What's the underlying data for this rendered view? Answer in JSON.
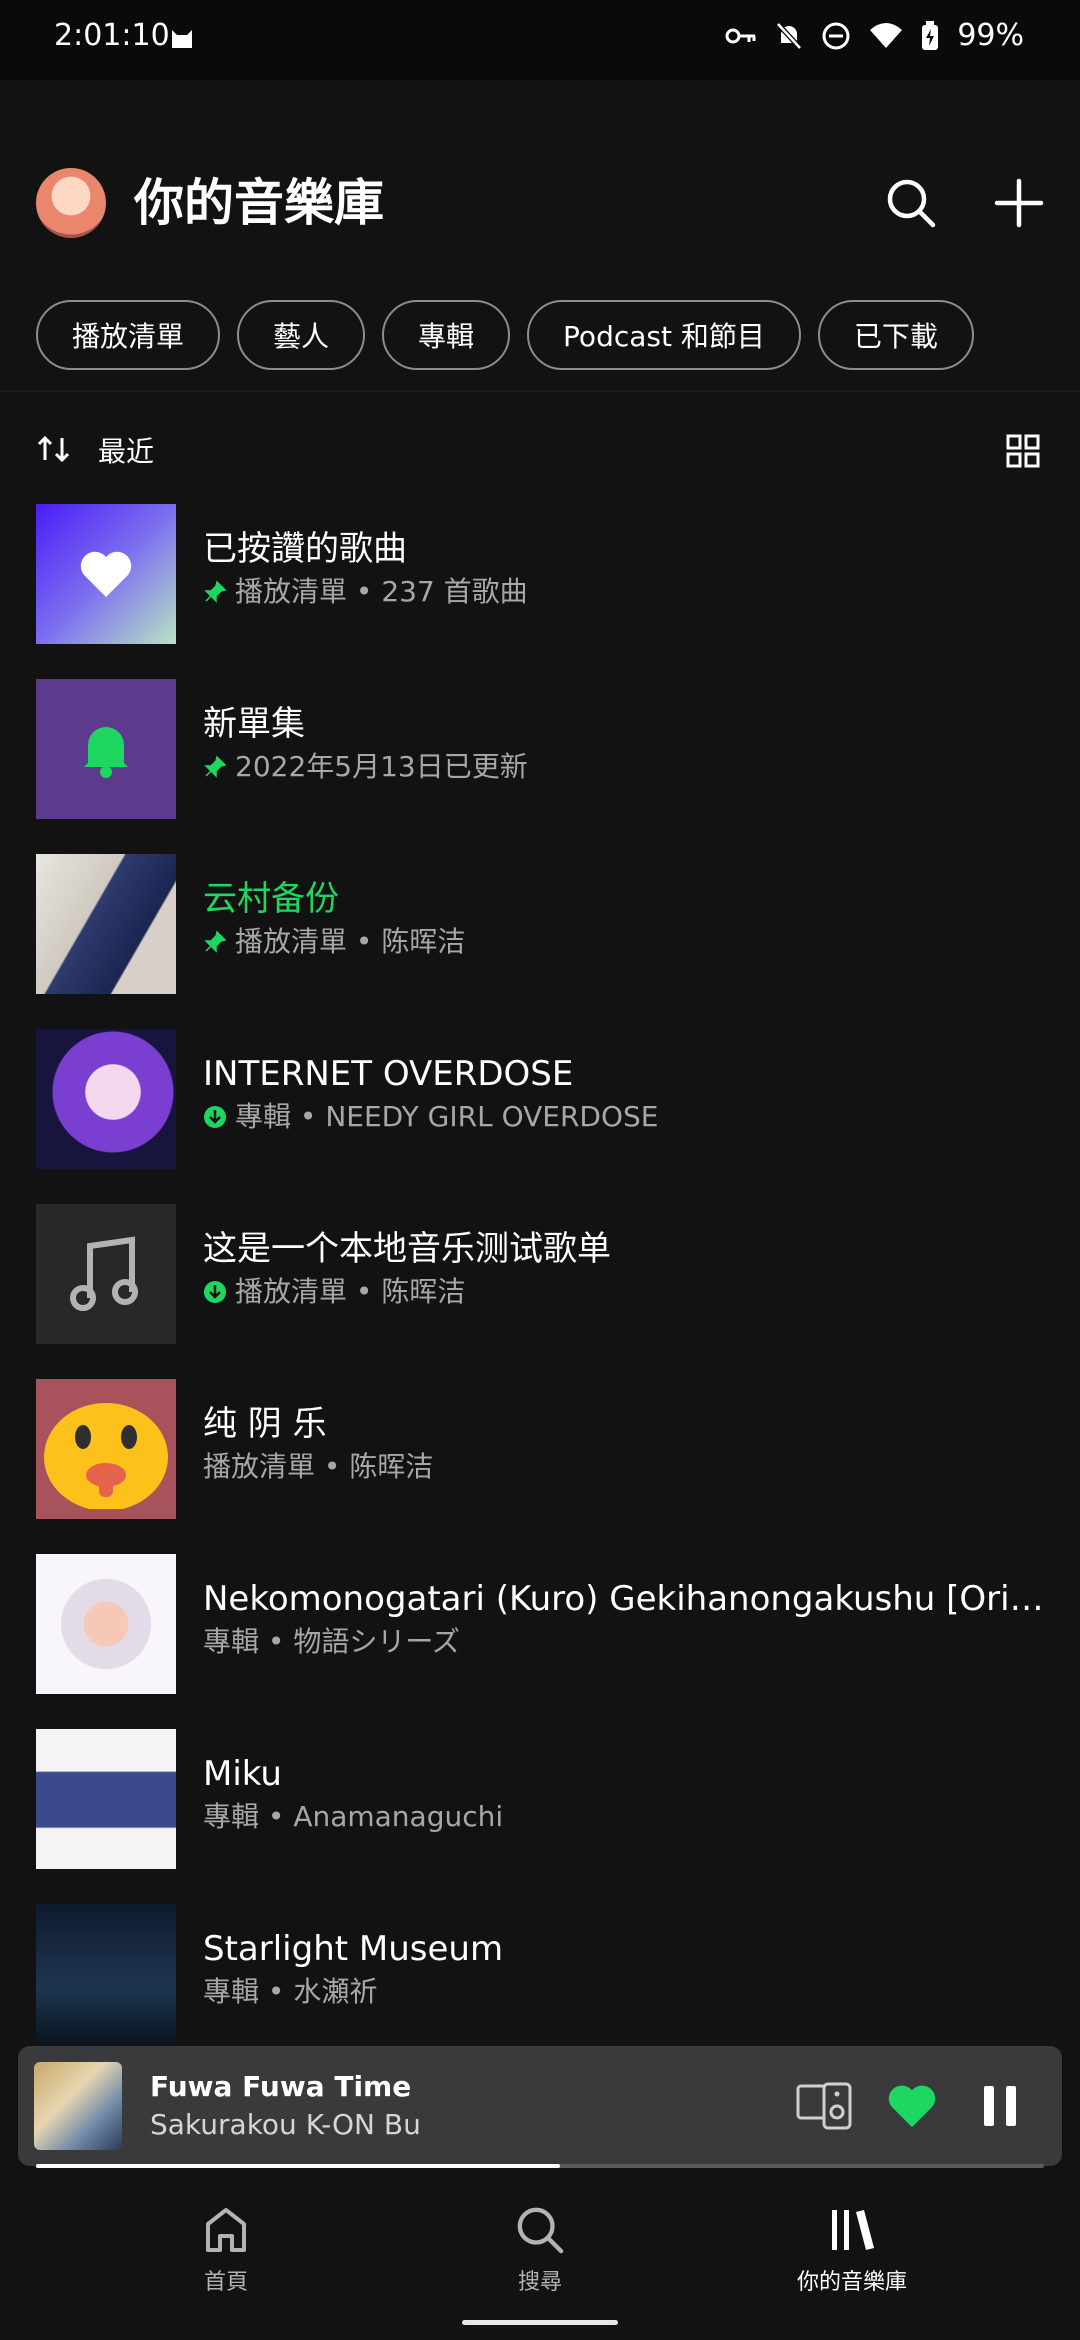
{
  "status": {
    "time": "2:01:10",
    "battery": "99%"
  },
  "header": {
    "title": "你的音樂庫"
  },
  "chips": [
    "播放清單",
    "藝人",
    "專輯",
    "Podcast 和節目",
    "已下載"
  ],
  "sort": {
    "label": "最近"
  },
  "library": [
    {
      "title": "已按讚的歌曲",
      "sub": "播放清單 • 237 首歌曲",
      "badge": "pin-icon",
      "thumb": "liked-songs"
    },
    {
      "title": "新單集",
      "sub": "2022年5月13日已更新",
      "badge": "pin-icon",
      "thumb": "new-episodes"
    },
    {
      "title": "云村备份",
      "sub": "播放清單 • 陈晖洁",
      "badge": "pin-icon",
      "thumb": "anime-art",
      "active": true
    },
    {
      "title": "INTERNET OVERDOSE",
      "sub": "專輯 • NEEDY GIRL OVERDOSE",
      "badge": "download-icon",
      "thumb": "album-art"
    },
    {
      "title": "这是一个本地音乐测试歌单",
      "sub": "播放清單 • 陈晖洁",
      "badge": "download-icon",
      "thumb": "music-note"
    },
    {
      "title": "纯 阴 乐",
      "sub": "播放清單 • 陈晖洁",
      "badge": "",
      "thumb": "emoji-face"
    },
    {
      "title": "Nekomonogatari (Kuro) Gekihanongakushu [Origin...",
      "sub": "專輯 • 物語シリーズ",
      "badge": "",
      "thumb": "album-art-light"
    },
    {
      "title": "Miku",
      "sub": "專輯 • Anamanaguchi",
      "badge": "",
      "thumb": "album-art-miku"
    },
    {
      "title": "Starlight Museum",
      "sub": "專輯 • 水瀬祈",
      "badge": "",
      "thumb": "album-art-dark"
    }
  ],
  "player": {
    "title": "Fuwa Fuwa Time",
    "artist": "Sakurakou K-ON Bu",
    "progress": 0.52
  },
  "nav": [
    {
      "label": "首頁",
      "icon": "home-icon"
    },
    {
      "label": "搜尋",
      "icon": "search-icon"
    },
    {
      "label": "你的音樂庫",
      "icon": "library-icon",
      "active": true
    }
  ],
  "colors": {
    "accent": "#1ed760",
    "background": "#121212"
  }
}
